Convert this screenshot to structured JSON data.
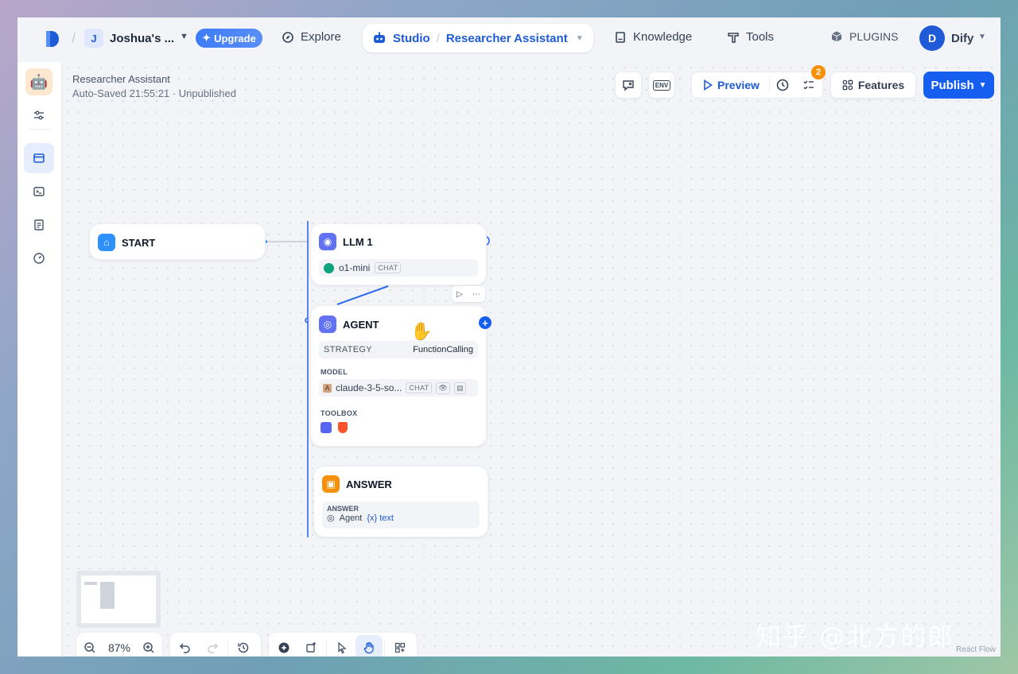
{
  "topnav": {
    "workspace_initial": "J",
    "workspace_name": "Joshua's ...",
    "upgrade_label": "Upgrade",
    "explore_label": "Explore",
    "studio_label": "Studio",
    "app_name": "Researcher Assistant",
    "knowledge_label": "Knowledge",
    "tools_label": "Tools",
    "plugins_label": "PLUGINS",
    "user_initial": "D",
    "user_name": "Dify"
  },
  "header": {
    "app_title": "Researcher Assistant",
    "status": "Auto-Saved 21:55:21 · Unpublished",
    "env_label": "ENV",
    "preview_label": "Preview",
    "checklist_count": "2",
    "features_label": "Features",
    "publish_label": "Publish"
  },
  "nodes": {
    "start": {
      "title": "START"
    },
    "llm": {
      "title": "LLM 1",
      "model": "o1-mini",
      "mode": "CHAT"
    },
    "agent": {
      "title": "AGENT",
      "strategy_label": "STRATEGY",
      "strategy_value": "FunctionCalling",
      "model_label": "MODEL",
      "model_value": "claude-3-5-so...",
      "model_mode": "CHAT",
      "toolbox_label": "TOOLBOX"
    },
    "answer": {
      "title": "ANSWER",
      "answer_label": "ANSWER",
      "source": "Agent",
      "var_prefix": "{x}",
      "var_name": "text"
    }
  },
  "controls": {
    "zoom": "87%"
  },
  "watermark": "知乎 @北方的郎",
  "react_flow": "React Flow",
  "colors": {
    "accent": "#155eef",
    "llm_icon": "#6172f3",
    "agent_icon": "#6172f3",
    "answer_icon": "#f79009",
    "start_icon": "#2e90fa"
  }
}
